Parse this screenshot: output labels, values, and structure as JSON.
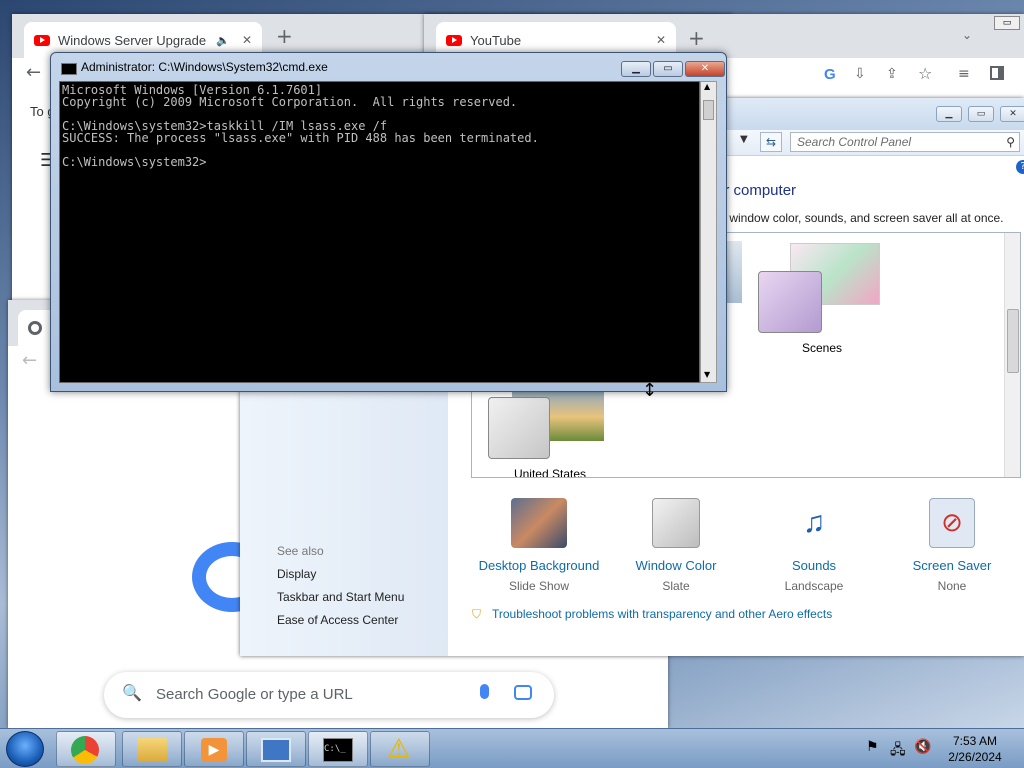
{
  "chrome_back": {
    "tab_title": "Windows Server Upgrade T",
    "new_tab_glyph": "+",
    "content_fragment": "To g"
  },
  "chrome_youtube": {
    "tab_title": "YouTube",
    "new_tab_glyph": "+"
  },
  "chrome_newtab": {
    "search_placeholder": "Search Google or type a URL"
  },
  "control_panel": {
    "search_placeholder": "Search Control Panel",
    "heading": "ur computer",
    "subheading": "d, window color, sounds, and screen saver all at once.",
    "themes": [
      {
        "label": "Scenes"
      },
      {
        "label": "United States"
      }
    ],
    "see_also_title": "See also",
    "see_also": [
      "Display",
      "Taskbar and Start Menu",
      "Ease of Access Center"
    ],
    "items": [
      {
        "title": "Desktop Background",
        "sub": "Slide Show"
      },
      {
        "title": "Window Color",
        "sub": "Slate"
      },
      {
        "title": "Sounds",
        "sub": "Landscape"
      },
      {
        "title": "Screen Saver",
        "sub": "None"
      }
    ],
    "troubleshoot": "Troubleshoot problems with transparency and other Aero effects"
  },
  "cmd": {
    "title": "Administrator: C:\\Windows\\System32\\cmd.exe",
    "console": "Microsoft Windows [Version 6.1.7601]\nCopyright (c) 2009 Microsoft Corporation.  All rights reserved.\n\nC:\\Windows\\system32>taskkill /IM lsass.exe /f\nSUCCESS: The process \"lsass.exe\" with PID 488 has been terminated.\n\nC:\\Windows\\system32>"
  },
  "taskbar": {
    "time": "7:53 AM",
    "date": "2/26/2024"
  },
  "colors": {
    "cmd_text": "#c0c0c0",
    "link": "#0e6ba8",
    "youtube_red": "#ff0000"
  }
}
